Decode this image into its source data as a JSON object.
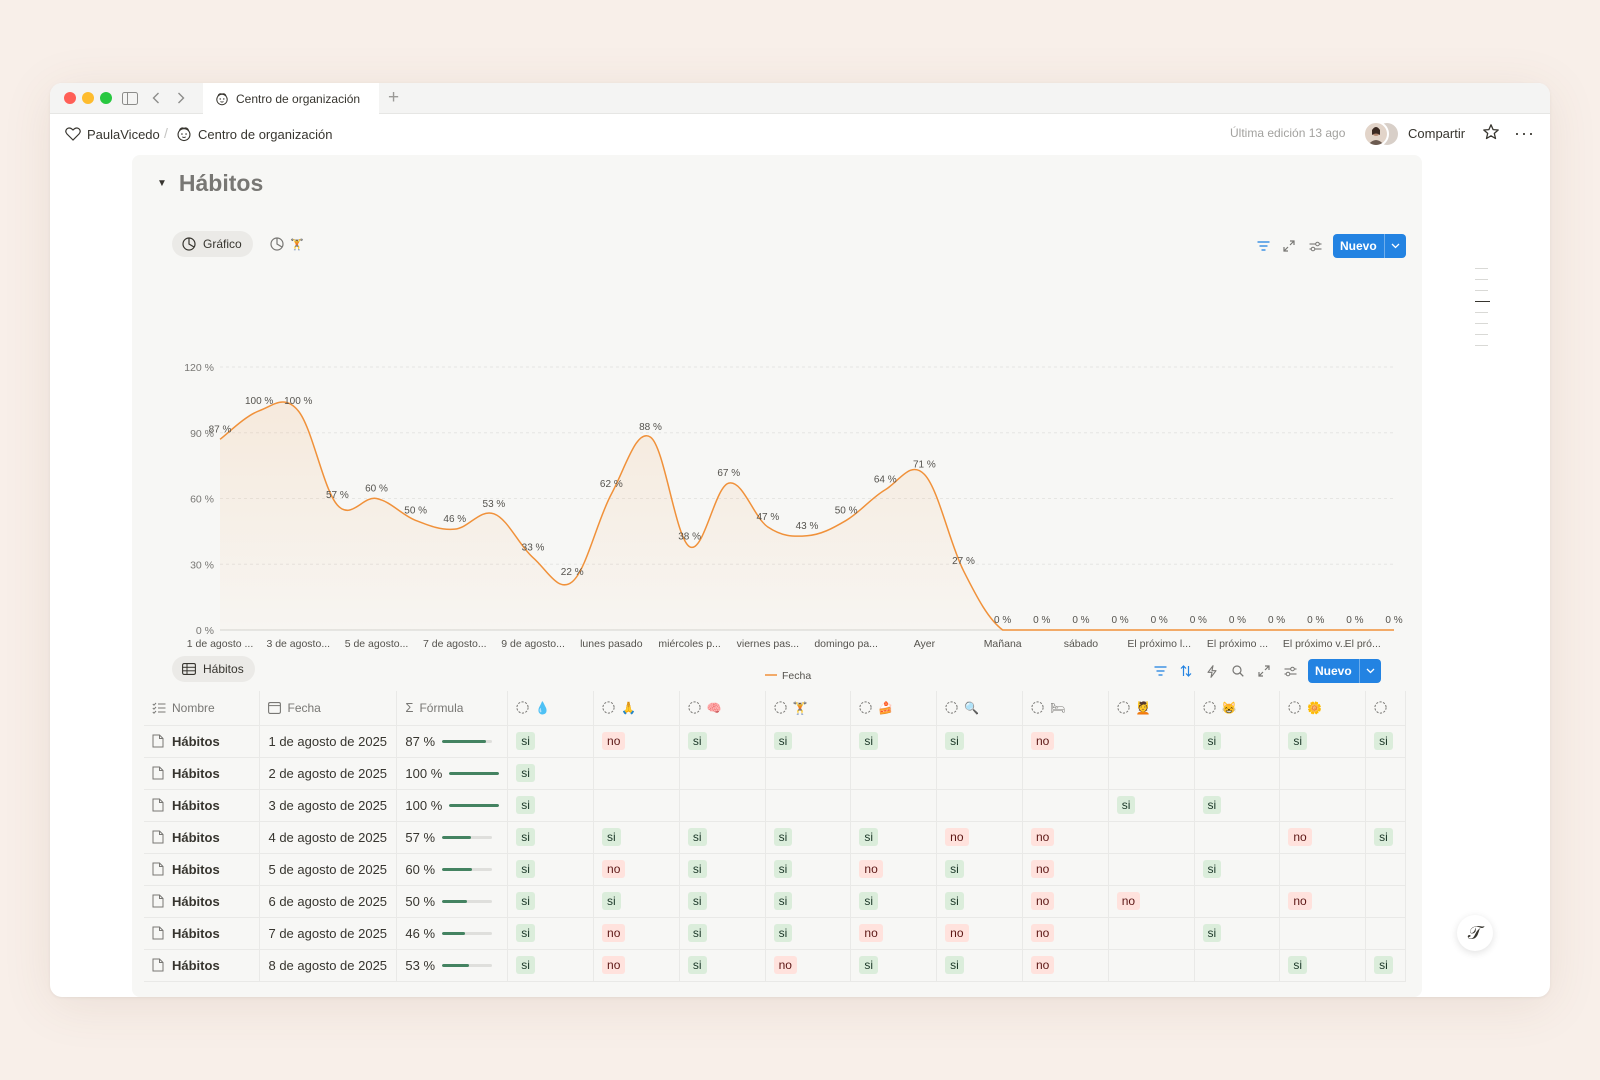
{
  "browser": {
    "tab_title": "Centro de organización",
    "new_tab_label": "+"
  },
  "topbar": {
    "breadcrumb_workspace": "PaulaVicedo",
    "breadcrumb_separator": "/",
    "breadcrumb_page": "Centro de organización",
    "last_edited": "Última edición 13 ago",
    "share_label": "Compartir",
    "more_label": "···"
  },
  "section": {
    "title": "Hábitos"
  },
  "chart_view": {
    "view_label": "Gráfico",
    "second_view_emoji": "🏋",
    "new_label": "Nuevo"
  },
  "chart_data": {
    "type": "area",
    "curve": "smooth",
    "color": "#f0913a",
    "ylim": [
      0,
      120
    ],
    "yticks": [
      "0 %",
      "30 %",
      "60 %",
      "90 %",
      "120 %"
    ],
    "ytick_values": [
      0,
      30,
      60,
      90,
      120
    ],
    "grid": true,
    "legend_position": "bottom-center",
    "series": [
      {
        "name": "Fecha",
        "values": [
          87,
          100,
          100,
          57,
          60,
          50,
          46,
          53,
          33,
          22,
          62,
          88,
          38,
          67,
          47,
          43,
          50,
          64,
          71,
          27,
          0,
          0,
          0,
          0,
          0,
          0,
          0,
          0,
          0,
          0,
          0
        ],
        "labels": [
          "87 %",
          "100 %",
          "100 %",
          "57 %",
          "60 %",
          "50 %",
          "46 %",
          "53 %",
          "33 %",
          "22 %",
          "62 %",
          "88 %",
          "38 %",
          "67 %",
          "47 %",
          "43 %",
          "50 %",
          "64 %",
          "71 %",
          "27 %",
          "0 %",
          "0 %",
          "0 %",
          "0 %",
          "0 %",
          "0 %",
          "0 %",
          "0 %",
          "0 %",
          "0 %",
          "0 %"
        ]
      }
    ],
    "xtick_labels": [
      "1 de agosto ...",
      "3 de agosto...",
      "5 de agosto...",
      "7 de agosto...",
      "9 de agosto...",
      "lunes pasado",
      "miércoles p...",
      "viernes pas...",
      "domingo pa...",
      "Ayer",
      "Mañana",
      "sábado",
      "El próximo l...",
      "El próximo ...",
      "El próximo v...",
      "El pró..."
    ],
    "xtick_positions": [
      0,
      2,
      4,
      6,
      8,
      10,
      12,
      14,
      16,
      18,
      20,
      22,
      24,
      26,
      28,
      29.2
    ]
  },
  "table_view": {
    "view_label": "Hábitos",
    "new_label": "Nuevo",
    "columns": [
      "Nombre",
      "Fecha",
      "Fórmula",
      "💧",
      "🙏",
      "🧠",
      "🏋",
      "🍰",
      "🔍",
      "🛏",
      "💆",
      "😸",
      "🌼",
      ""
    ],
    "rows": [
      {
        "name": "Hábitos",
        "date": "1 de agosto de 2025",
        "formula": "87 %",
        "progress": 0.87,
        "checks": [
          "si",
          "no",
          "si",
          "si",
          "si",
          "si",
          "no",
          "",
          "si",
          "si",
          "si"
        ]
      },
      {
        "name": "Hábitos",
        "date": "2 de agosto de 2025",
        "formula": "100 %",
        "progress": 1.0,
        "checks": [
          "si",
          "",
          "",
          "",
          "",
          "",
          "",
          "",
          "",
          "",
          ""
        ]
      },
      {
        "name": "Hábitos",
        "date": "3 de agosto de 2025",
        "formula": "100 %",
        "progress": 1.0,
        "checks": [
          "si",
          "",
          "",
          "",
          "",
          "",
          "",
          "si",
          "si",
          "",
          ""
        ]
      },
      {
        "name": "Hábitos",
        "date": "4 de agosto de 2025",
        "formula": "57 %",
        "progress": 0.57,
        "checks": [
          "si",
          "si",
          "si",
          "si",
          "si",
          "no",
          "no",
          "",
          "",
          "no",
          "si"
        ]
      },
      {
        "name": "Hábitos",
        "date": "5 de agosto de 2025",
        "formula": "60 %",
        "progress": 0.6,
        "checks": [
          "si",
          "no",
          "si",
          "si",
          "no",
          "si",
          "no",
          "",
          "si",
          "",
          ""
        ]
      },
      {
        "name": "Hábitos",
        "date": "6 de agosto de 2025",
        "formula": "50 %",
        "progress": 0.5,
        "checks": [
          "si",
          "si",
          "si",
          "si",
          "si",
          "si",
          "no",
          "no",
          "",
          "no",
          ""
        ]
      },
      {
        "name": "Hábitos",
        "date": "7 de agosto de 2025",
        "formula": "46 %",
        "progress": 0.46,
        "checks": [
          "si",
          "no",
          "si",
          "si",
          "no",
          "no",
          "no",
          "",
          "si",
          "",
          ""
        ]
      },
      {
        "name": "Hábitos",
        "date": "8 de agosto de 2025",
        "formula": "53 %",
        "progress": 0.53,
        "checks": [
          "si",
          "no",
          "si",
          "no",
          "si",
          "si",
          "no",
          "",
          "",
          "si",
          "si"
        ]
      }
    ]
  },
  "help_button": "𝒯",
  "colors": {
    "accent": "#2383e2",
    "chart_line": "#f0913a",
    "tag_yes_bg": "#dbeddb",
    "tag_no_bg": "#ffe2dd",
    "progress": "#448361"
  }
}
